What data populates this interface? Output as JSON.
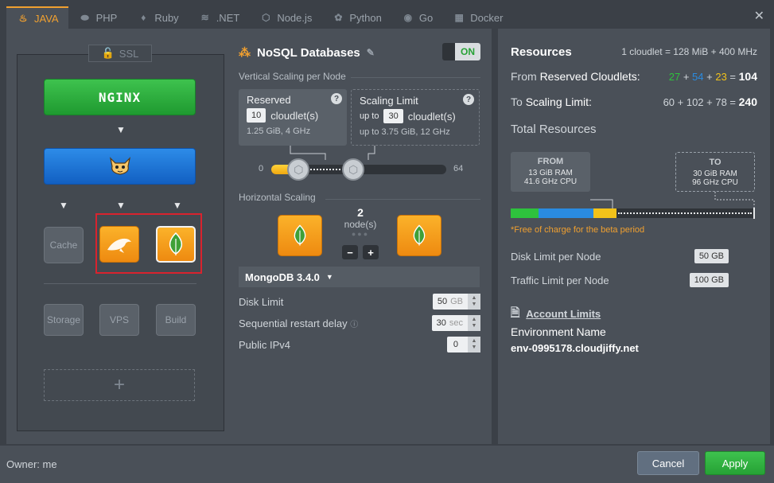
{
  "tabs": [
    {
      "label": "JAVA",
      "icon": "java-icon",
      "glyph": "♨",
      "active": true
    },
    {
      "label": "PHP",
      "icon": "php-icon",
      "glyph": "⬬",
      "active": false
    },
    {
      "label": "Ruby",
      "icon": "ruby-icon",
      "glyph": "♦",
      "active": false
    },
    {
      "label": ".NET",
      "icon": "dotnet-icon",
      "glyph": "≋",
      "active": false
    },
    {
      "label": "Node.js",
      "icon": "nodejs-icon",
      "glyph": "⬡",
      "active": false
    },
    {
      "label": "Python",
      "icon": "python-icon",
      "glyph": "✿",
      "active": false
    },
    {
      "label": "Go",
      "icon": "go-icon",
      "glyph": "◉",
      "active": false
    },
    {
      "label": "Docker",
      "icon": "docker-icon",
      "glyph": "▦",
      "active": false
    }
  ],
  "topology": {
    "ssl_label": "SSL",
    "nginx_label": "NGINX",
    "cache_label": "Cache",
    "storage_label": "Storage",
    "vps_label": "VPS",
    "build_label": "Build",
    "add_label": "+"
  },
  "middle": {
    "title": "NoSQL Databases",
    "toggle_label": "ON",
    "vertical_label": "Vertical Scaling per Node",
    "reserved": {
      "title": "Reserved",
      "value": "10",
      "unit": "cloudlet(s)",
      "sub": "1.25 GiB, 4 GHz"
    },
    "scaling": {
      "title": "Scaling Limit",
      "prefix": "up to",
      "value": "30",
      "unit": "cloudlet(s)",
      "sub": "3.75 GiB, 12 GHz"
    },
    "slider_min": "0",
    "slider_max": "64",
    "reserved_cloudlets": 10,
    "limit_cloudlets": 30,
    "max_cloudlets": 64,
    "horizontal_label": "Horizontal Scaling",
    "nodes_count": "2",
    "nodes_label": "node(s)",
    "minus": "−",
    "plus": "+",
    "version": "MongoDB 3.4.0",
    "disk_limit_label": "Disk Limit",
    "disk_limit_value": "50",
    "disk_limit_unit": "GB",
    "restart_label": "Sequential restart delay",
    "restart_value": "30",
    "restart_unit": "sec",
    "ipv4_label": "Public IPv4",
    "ipv4_value": "0"
  },
  "right": {
    "title": "Resources",
    "info": "1 cloudlet = 128 MiB + 400 MHz",
    "reserved_pre": "From ",
    "reserved_label": "Reserved Cloudlets:",
    "reserved_a": "27",
    "reserved_b": "54",
    "reserved_c": "23",
    "reserved_total": "104",
    "limit_pre": "To ",
    "limit_label": "Scaling Limit:",
    "limit_vals": "60 + 102 + 78 =",
    "limit_total": "240",
    "total_label": "Total Resources",
    "from_h": "FROM",
    "from_ram": "13 GiB RAM",
    "from_cpu": "41.6 GHz CPU",
    "to_h": "TO",
    "to_ram": "30 GiB RAM",
    "to_cpu": "96 GHz CPU",
    "segments": [
      {
        "value": 27,
        "color": "#2ec23d"
      },
      {
        "value": 54,
        "color": "#2a8be0"
      },
      {
        "value": 23,
        "color": "#f2c21a"
      }
    ],
    "scale_max": 240,
    "beta_note": "*Free of charge for the beta period",
    "disk_label": "Disk Limit per Node",
    "disk_value": "50 GB",
    "traffic_label": "Traffic Limit per Node",
    "traffic_value": "100 GB",
    "account_limits": "Account Limits",
    "env_label": "Environment Name",
    "env_value": "env-0995178.cloudjiffy.net"
  },
  "footer": {
    "owner": "Owner: me",
    "cancel": "Cancel",
    "apply": "Apply"
  },
  "colors": {
    "accent": "#f0a030",
    "apply": "#26a235",
    "selection": "#d9232e"
  }
}
